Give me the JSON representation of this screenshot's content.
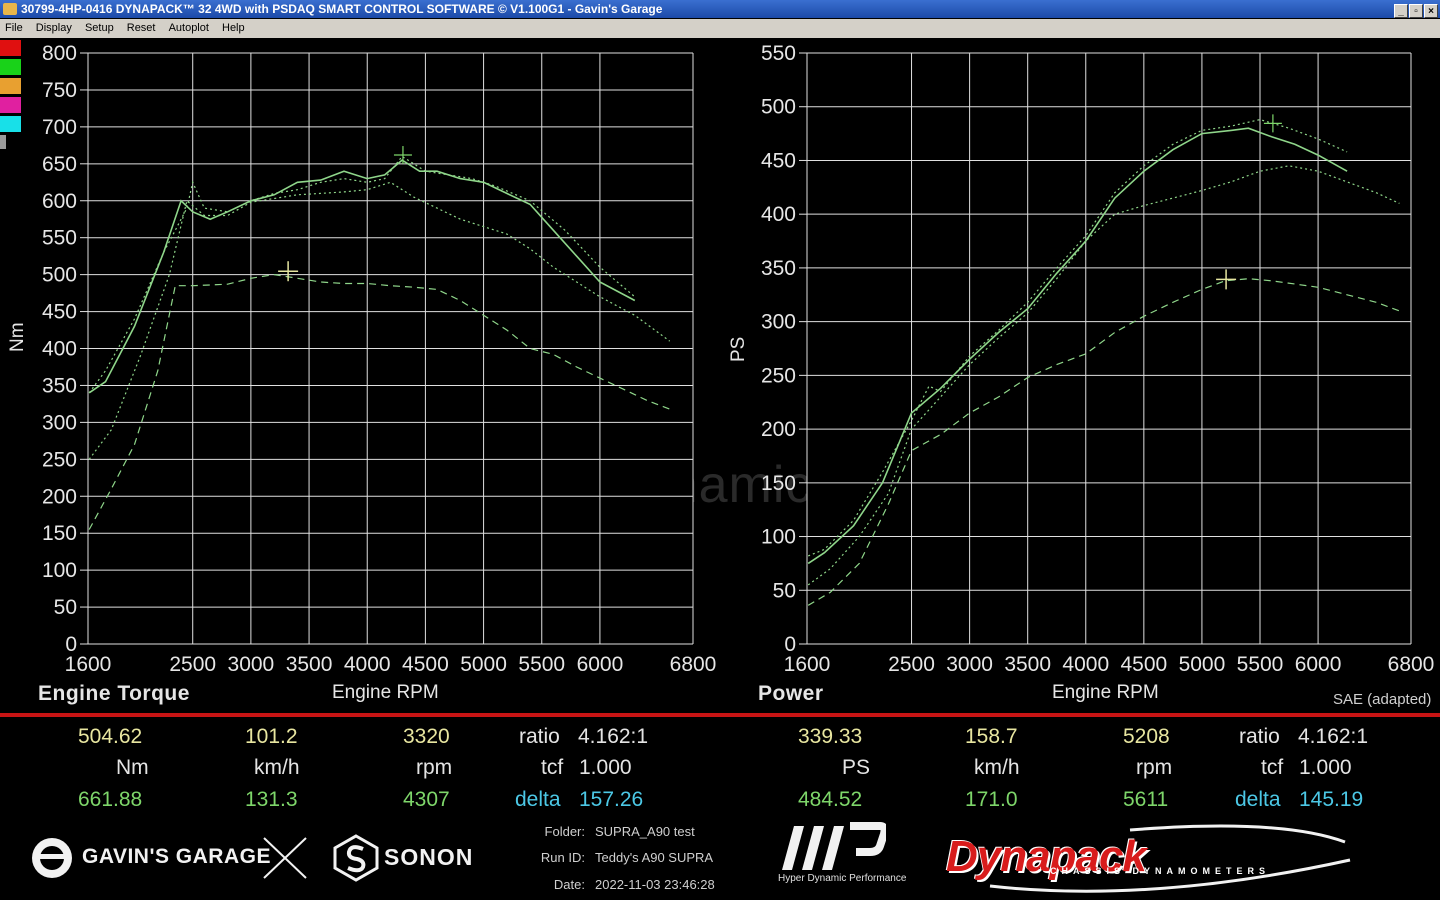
{
  "window": {
    "title": "30799-4HP-0416 DYNAPACK™ 32 4WD with PSDAQ SMART CONTROL SOFTWARE © V1.100G1 - Gavin's Garage",
    "buttons": [
      "_",
      "▫",
      "×"
    ]
  },
  "menu": [
    "File",
    "Display",
    "Setup",
    "Reset",
    "Autoplot",
    "Help"
  ],
  "run_colors": [
    "#e01010",
    "#19d219",
    "#e8a030",
    "#e020a0",
    "#18e0e8"
  ],
  "watermark": "Hyper Dynamic Performance",
  "chart_data": [
    {
      "type": "line",
      "title": "Engine Torque",
      "xlabel": "Engine RPM",
      "ylabel": "Nm",
      "xlim": [
        1600,
        6800
      ],
      "ylim": [
        0,
        800
      ],
      "xticks": [
        1600,
        2500,
        3000,
        3500,
        4000,
        4500,
        5000,
        5500,
        6000,
        6800
      ],
      "yticks": [
        0,
        50,
        100,
        150,
        200,
        250,
        300,
        350,
        400,
        450,
        500,
        550,
        600,
        650,
        700,
        750,
        800
      ],
      "grid": true,
      "color": "#8fd68a",
      "series": [
        {
          "style": "solid",
          "x": [
            1610,
            1750,
            2000,
            2250,
            2400,
            2500,
            2650,
            2800,
            3000,
            3200,
            3400,
            3600,
            3800,
            4000,
            4150,
            4300,
            4450,
            4600,
            4800,
            5000,
            5200,
            5400,
            5600,
            5800,
            6000,
            6300
          ],
          "y": [
            340,
            355,
            430,
            530,
            600,
            585,
            575,
            585,
            600,
            608,
            625,
            628,
            640,
            630,
            635,
            655,
            640,
            640,
            630,
            625,
            610,
            595,
            560,
            525,
            490,
            465
          ]
        },
        {
          "style": "dotted",
          "x": [
            1610,
            1750,
            2000,
            2250,
            2450,
            2500,
            2600,
            2800,
            3000,
            3200,
            3400,
            3600,
            3800,
            4000,
            4150,
            4300,
            4500,
            4700,
            4900,
            5100,
            5400,
            5700,
            6000,
            6300
          ],
          "y": [
            340,
            370,
            440,
            530,
            590,
            625,
            590,
            585,
            600,
            610,
            615,
            625,
            630,
            625,
            630,
            660,
            640,
            635,
            630,
            620,
            600,
            560,
            510,
            470
          ]
        },
        {
          "style": "dotted",
          "x": [
            1610,
            1800,
            2050,
            2300,
            2450,
            2600,
            2800,
            3000,
            3200,
            3400,
            3600,
            3800,
            4000,
            4200,
            4400,
            4600,
            4800,
            5000,
            5200,
            5400,
            5600,
            5800,
            6000,
            6300,
            6600
          ],
          "y": [
            250,
            290,
            390,
            500,
            600,
            580,
            580,
            598,
            603,
            608,
            610,
            612,
            615,
            625,
            605,
            590,
            575,
            565,
            555,
            535,
            510,
            490,
            470,
            445,
            410
          ]
        },
        {
          "style": "dashed",
          "x": [
            1610,
            1800,
            2000,
            2200,
            2350,
            2500,
            2800,
            3000,
            3200,
            3400,
            3600,
            3800,
            4000,
            4200,
            4400,
            4600,
            4800,
            5000,
            5200,
            5400,
            5600,
            5800,
            6000,
            6200,
            6400,
            6600
          ],
          "y": [
            155,
            210,
            270,
            370,
            485,
            485,
            487,
            495,
            500,
            495,
            490,
            488,
            488,
            485,
            483,
            480,
            465,
            445,
            425,
            400,
            392,
            375,
            360,
            345,
            330,
            318
          ]
        }
      ],
      "cursor": {
        "rpm": 3320,
        "value": 504.62
      },
      "peak_marker": {
        "rpm": 4307,
        "value": 661.88
      }
    },
    {
      "type": "line",
      "title": "Power",
      "xlabel": "Engine RPM",
      "ylabel": "PS",
      "xlim": [
        1600,
        6800
      ],
      "ylim": [
        0,
        550
      ],
      "xticks": [
        1600,
        2500,
        3000,
        3500,
        4000,
        4500,
        5000,
        5500,
        6000,
        6800
      ],
      "yticks": [
        0,
        50,
        100,
        150,
        200,
        250,
        300,
        350,
        400,
        450,
        500,
        550
      ],
      "grid": true,
      "note": "SAE (adapted)",
      "color": "#8fd68a",
      "series": [
        {
          "style": "solid",
          "x": [
            1610,
            1750,
            2000,
            2250,
            2500,
            2750,
            3000,
            3250,
            3500,
            3750,
            4000,
            4250,
            4500,
            4750,
            5000,
            5250,
            5400,
            5600,
            5800,
            6000,
            6250
          ],
          "y": [
            75,
            85,
            110,
            150,
            215,
            238,
            265,
            290,
            312,
            345,
            375,
            415,
            440,
            460,
            475,
            478,
            480,
            472,
            465,
            455,
            440
          ]
        },
        {
          "style": "dotted",
          "x": [
            1610,
            1750,
            2000,
            2250,
            2500,
            2650,
            2750,
            3000,
            3250,
            3500,
            3750,
            4000,
            4250,
            4500,
            4750,
            5000,
            5250,
            5500,
            5750,
            6000,
            6250
          ],
          "y": [
            82,
            88,
            115,
            160,
            208,
            240,
            235,
            268,
            292,
            318,
            350,
            380,
            420,
            445,
            465,
            478,
            482,
            488,
            480,
            470,
            458
          ]
        },
        {
          "style": "dotted",
          "x": [
            1610,
            1800,
            2050,
            2300,
            2500,
            2750,
            3000,
            3250,
            3500,
            3750,
            4000,
            4250,
            4500,
            4750,
            5000,
            5250,
            5500,
            5750,
            6000,
            6250,
            6500,
            6700
          ],
          "y": [
            55,
            70,
            100,
            140,
            200,
            230,
            260,
            285,
            308,
            340,
            375,
            400,
            408,
            415,
            422,
            430,
            440,
            445,
            440,
            430,
            420,
            410
          ]
        },
        {
          "style": "dashed",
          "x": [
            1610,
            1800,
            2050,
            2300,
            2500,
            2750,
            3000,
            3250,
            3500,
            3750,
            4000,
            4250,
            4500,
            4750,
            5000,
            5200,
            5400,
            5600,
            5800,
            6000,
            6250,
            6500,
            6700
          ],
          "y": [
            36,
            48,
            75,
            130,
            180,
            195,
            215,
            230,
            248,
            260,
            270,
            290,
            305,
            318,
            330,
            338,
            340,
            338,
            335,
            332,
            325,
            318,
            310
          ]
        }
      ],
      "cursor": {
        "rpm": 5208,
        "value": 339.33
      },
      "peak_marker": {
        "rpm": 5611,
        "value": 484.52
      }
    }
  ],
  "readout": {
    "torque": {
      "cursor": {
        "value": "504.62",
        "speed": "101.2",
        "rpm": "3320"
      },
      "units": {
        "value": "Nm",
        "speed": "km/h",
        "rpm": "rpm"
      },
      "peak": {
        "value": "661.88",
        "speed": "131.3",
        "rpm": "4307"
      },
      "ratio_label": "ratio",
      "ratio": "4.162:1",
      "tcf_label": "tcf",
      "tcf": "1.000",
      "delta_label": "delta",
      "delta": "157.26"
    },
    "power": {
      "cursor": {
        "value": "339.33",
        "speed": "158.7",
        "rpm": "5208"
      },
      "units": {
        "value": "PS",
        "speed": "km/h",
        "rpm": "rpm"
      },
      "peak": {
        "value": "484.52",
        "speed": "171.0",
        "rpm": "5611"
      },
      "ratio_label": "ratio",
      "ratio": "4.162:1",
      "tcf_label": "tcf",
      "tcf": "1.000",
      "delta_label": "delta",
      "delta": "145.19"
    }
  },
  "run_info": {
    "folder_label": "Folder:",
    "folder": "SUPRA_A90 test",
    "run_label": "Run ID:",
    "run": "Teddy's A90 SUPRA",
    "date_label": "Date:",
    "date": "2022-11-03 23:46:28"
  },
  "logos": {
    "garage": "GAVIN'S GARAGE",
    "sonon": "SONON",
    "hdp": "Hyper Dynamic Performance",
    "dynapack": "Dynapack",
    "dynapack_sub": "CHASSIS DYNAMOMETERS"
  }
}
